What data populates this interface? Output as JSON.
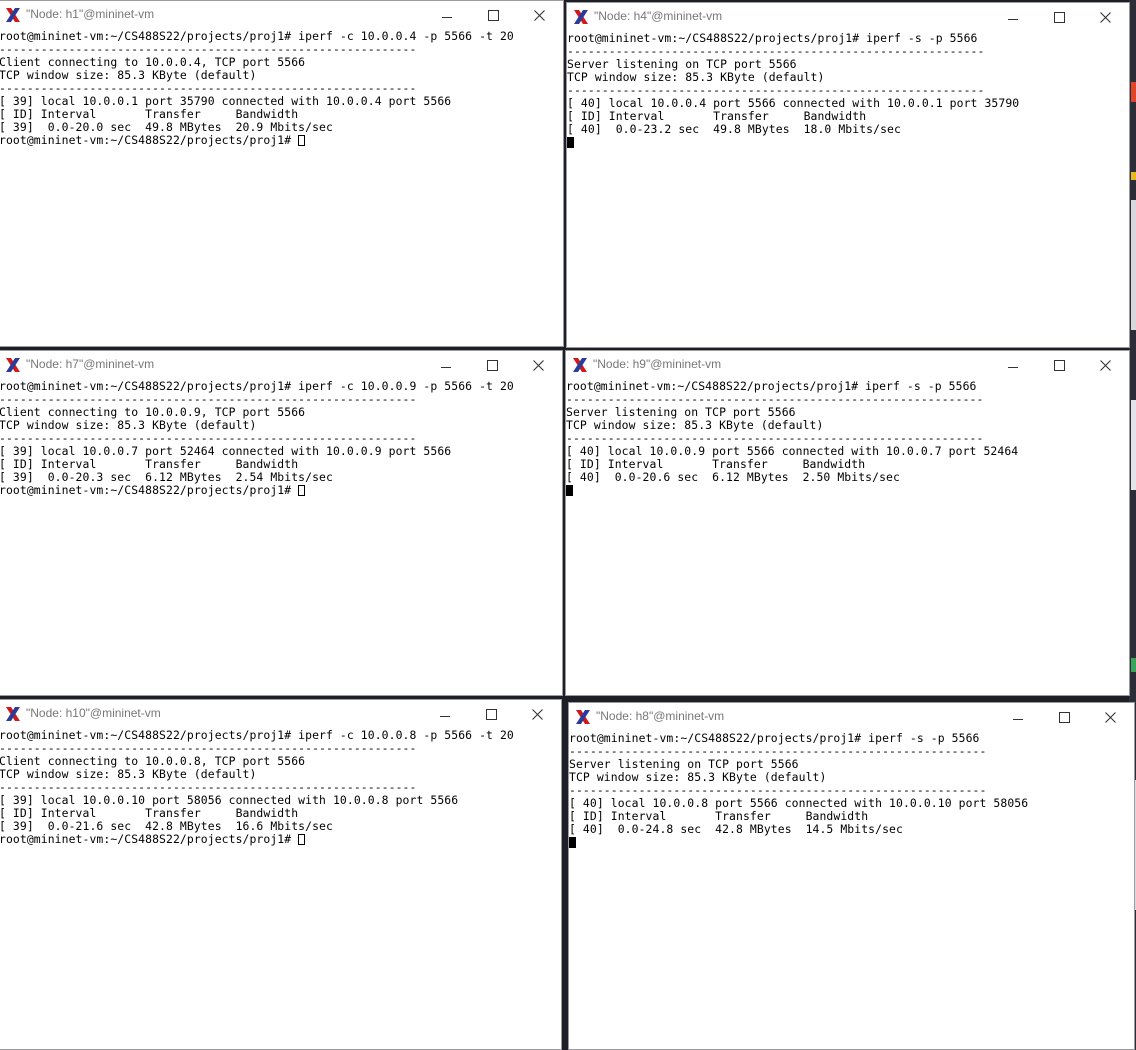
{
  "windows": {
    "h1": {
      "title": "\"Node: h1\"@mininet-vm",
      "lines": [
        "root@mininet-vm:~/CS488S22/projects/proj1# iperf -c 10.0.0.4 -p 5566 -t 20",
        "------------------------------------------------------------",
        "Client connecting to 10.0.0.4, TCP port 5566",
        "TCP window size: 85.3 KByte (default)",
        "------------------------------------------------------------",
        "[ 39] local 10.0.0.1 port 35790 connected with 10.0.0.4 port 5566",
        "[ ID] Interval       Transfer     Bandwidth",
        "[ 39]  0.0-20.0 sec  49.8 MBytes  20.9 Mbits/sec"
      ],
      "prompt": "root@mininet-vm:~/CS488S22/projects/proj1# "
    },
    "h4": {
      "title": "\"Node: h4\"@mininet-vm",
      "lines": [
        "root@mininet-vm:~/CS488S22/projects/proj1# iperf -s -p 5566",
        "------------------------------------------------------------",
        "Server listening on TCP port 5566",
        "TCP window size: 85.3 KByte (default)",
        "------------------------------------------------------------",
        "[ 40] local 10.0.0.4 port 5566 connected with 10.0.0.1 port 35790",
        "[ ID] Interval       Transfer     Bandwidth",
        "[ 40]  0.0-23.2 sec  49.8 MBytes  18.0 Mbits/sec"
      ]
    },
    "h7": {
      "title": "\"Node: h7\"@mininet-vm",
      "lines": [
        "root@mininet-vm:~/CS488S22/projects/proj1# iperf -c 10.0.0.9 -p 5566 -t 20",
        "------------------------------------------------------------",
        "Client connecting to 10.0.0.9, TCP port 5566",
        "TCP window size: 85.3 KByte (default)",
        "------------------------------------------------------------",
        "[ 39] local 10.0.0.7 port 52464 connected with 10.0.0.9 port 5566",
        "[ ID] Interval       Transfer     Bandwidth",
        "[ 39]  0.0-20.3 sec  6.12 MBytes  2.54 Mbits/sec"
      ],
      "prompt": "root@mininet-vm:~/CS488S22/projects/proj1# "
    },
    "h9": {
      "title": "\"Node: h9\"@mininet-vm",
      "lines": [
        "root@mininet-vm:~/CS488S22/projects/proj1# iperf -s -p 5566",
        "------------------------------------------------------------",
        "Server listening on TCP port 5566",
        "TCP window size: 85.3 KByte (default)",
        "------------------------------------------------------------",
        "[ 40] local 10.0.0.9 port 5566 connected with 10.0.0.7 port 52464",
        "[ ID] Interval       Transfer     Bandwidth",
        "[ 40]  0.0-20.6 sec  6.12 MBytes  2.50 Mbits/sec"
      ]
    },
    "h10": {
      "title": "\"Node: h10\"@mininet-vm",
      "lines": [
        "root@mininet-vm:~/CS488S22/projects/proj1# iperf -c 10.0.0.8 -p 5566 -t 20",
        "------------------------------------------------------------",
        "Client connecting to 10.0.0.8, TCP port 5566",
        "TCP window size: 85.3 KByte (default)",
        "------------------------------------------------------------",
        "[ 39] local 10.0.0.10 port 58056 connected with 10.0.0.8 port 5566",
        "[ ID] Interval       Transfer     Bandwidth",
        "[ 39]  0.0-21.6 sec  42.8 MBytes  16.6 Mbits/sec"
      ],
      "prompt": "root@mininet-vm:~/CS488S22/projects/proj1# "
    },
    "h8": {
      "title": "\"Node: h8\"@mininet-vm",
      "lines": [
        "root@mininet-vm:~/CS488S22/projects/proj1# iperf -s -p 5566",
        "------------------------------------------------------------",
        "Server listening on TCP port 5566",
        "TCP window size: 85.3 KByte (default)",
        "------------------------------------------------------------",
        "[ 40] local 10.0.0.8 port 5566 connected with 10.0.0.10 port 58056",
        "[ ID] Interval       Transfer     Bandwidth",
        "[ 40]  0.0-24.8 sec  42.8 MBytes  14.5 Mbits/sec"
      ]
    }
  },
  "colors": {
    "terminal_bg": "#ffffff",
    "terminal_fg": "#000000",
    "title_text": "#777777",
    "x_logo_red": "#d01919",
    "x_logo_blue": "#2a3b9a",
    "desktop_bg": "#1c1f26"
  },
  "icons": {
    "app_icon": "x11-logo-icon",
    "minimize": "minimize-icon",
    "maximize": "maximize-icon",
    "close": "close-icon"
  }
}
